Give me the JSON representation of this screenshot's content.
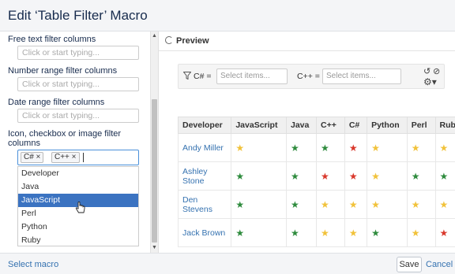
{
  "dialog": {
    "title": "Edit ‘Table Filter’ Macro"
  },
  "left_panel": {
    "fields": [
      {
        "label": "Free text filter columns",
        "placeholder": "Click or start typing..."
      },
      {
        "label": "Number range filter columns",
        "placeholder": "Click or start typing..."
      },
      {
        "label": "Date range filter columns",
        "placeholder": "Click or start typing..."
      }
    ],
    "multi_field": {
      "label_line1": "Icon, checkbox or image filter",
      "label_line2": "columns",
      "tags": [
        "C# ×",
        "C++ ×"
      ]
    },
    "dropdown": {
      "options": [
        "Developer",
        "Java",
        "JavaScript",
        "Perl",
        "Python",
        "Ruby"
      ],
      "highlighted": "JavaScript"
    }
  },
  "preview": {
    "title": "Preview",
    "filters": [
      {
        "label": "C# =",
        "placeholder": "Select items..."
      },
      {
        "label": "C++ =",
        "placeholder": "Select items..."
      }
    ],
    "table": {
      "headers": [
        "Developer",
        "JavaScript",
        "Java",
        "C++",
        "C#",
        "Python",
        "Perl",
        "Ruby"
      ],
      "rows": [
        {
          "developer": "Andy Miller",
          "stars": [
            "yellow",
            "green",
            "green",
            "red",
            "yellow",
            "yellow",
            "yellow"
          ]
        },
        {
          "developer": "Ashley Stone",
          "stars": [
            "green",
            "green",
            "red",
            "red",
            "yellow",
            "green",
            "green"
          ]
        },
        {
          "developer": "Den Stevens",
          "stars": [
            "green",
            "green",
            "yellow",
            "yellow",
            "yellow",
            "yellow",
            "yellow"
          ]
        },
        {
          "developer": "Jack Brown",
          "stars": [
            "green",
            "green",
            "yellow",
            "yellow",
            "green",
            "yellow",
            "red"
          ]
        }
      ]
    },
    "star_colors": {
      "green": "#2e8b3d",
      "red": "#d9382c",
      "yellow": "#f1c23a"
    }
  },
  "footer": {
    "select_macro": "Select macro",
    "save": "Save",
    "cancel": "Cancel"
  }
}
